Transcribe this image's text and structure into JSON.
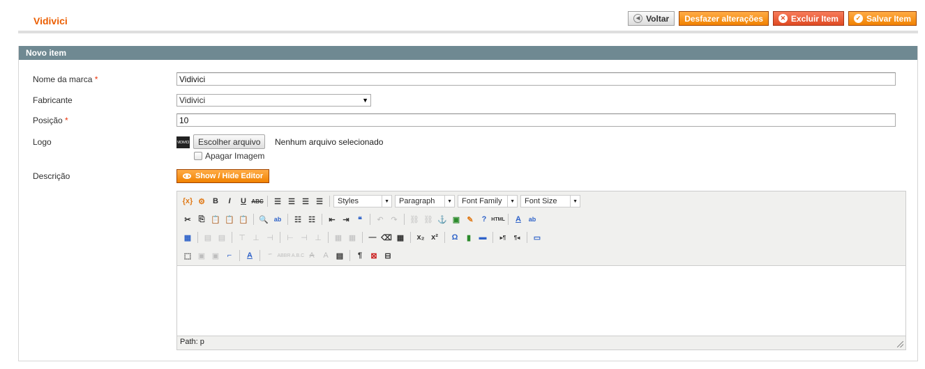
{
  "page": {
    "title": "Vidivici"
  },
  "actions": {
    "back": "Voltar",
    "reset": "Desfazer alterações",
    "delete": "Excluir Item",
    "save": "Salvar Item"
  },
  "panel": {
    "title": "Novo item"
  },
  "form": {
    "brand_name": {
      "label": "Nome da marca",
      "required_mark": "*",
      "value": "Vidivici"
    },
    "manufacturer": {
      "label": "Fabricante",
      "value": "Vidivici"
    },
    "position": {
      "label": "Posição",
      "required_mark": "*",
      "value": "10"
    },
    "logo": {
      "label": "Logo",
      "thumb_text": "VIDIVICI",
      "choose_button": "Escolher arquivo",
      "status": "Nenhum arquivo selecionado",
      "delete_checkbox_label": "Apagar Imagem",
      "delete_checked": false
    },
    "description": {
      "label": "Descrição",
      "toggle_button": "Show / Hide Editor"
    }
  },
  "editor": {
    "dropdowns": {
      "styles": "Styles",
      "format": "Paragraph",
      "font_family": "Font Family",
      "font_size": "Font Size"
    },
    "path": "Path: p"
  },
  "colors": {
    "accent": "#eb5e00",
    "panel_header": "#6f8992",
    "button_orange": "#f18200",
    "button_red": "#e04a22"
  }
}
